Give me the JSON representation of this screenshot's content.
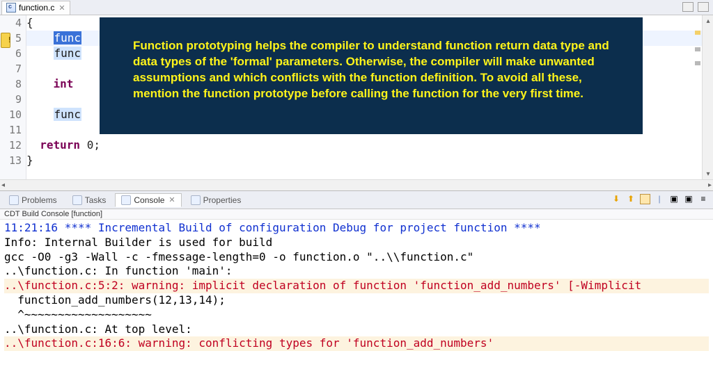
{
  "tab": {
    "filename": "function.c"
  },
  "gutter": [
    "4",
    "5",
    "6",
    "7",
    "8",
    "9",
    "10",
    "11",
    "12",
    "13"
  ],
  "code": {
    "l4": "{",
    "l5a": "    ",
    "l5b": "func",
    "l6a": "    ",
    "l6b": "func",
    "l7": "",
    "l8a": "    ",
    "l8kw": "int",
    "l8b": " ",
    "l9": "",
    "l10a": "    ",
    "l10b": "func",
    "l11": "",
    "l12a": "  ",
    "l12kw": "return",
    "l12b": " 0;",
    "l13": "}"
  },
  "tooltip": "Function prototyping helps the compiler to understand function return data type and data types of the 'formal' parameters. Otherwise, the compiler will make unwanted assumptions and which conflicts with the function definition. To avoid all these, mention the function prototype before calling the function for the very first time.",
  "panel": {
    "tab_problems": "Problems",
    "tab_tasks": "Tasks",
    "tab_console": "Console",
    "tab_properties": "Properties",
    "console_title": "CDT Build Console [function]"
  },
  "console": {
    "l1": "11:21:16 **** Incremental Build of configuration Debug for project function ****",
    "l2": "Info: Internal Builder is used for build",
    "l3": "gcc -O0 -g3 -Wall -c -fmessage-length=0 -o function.o \"..\\\\function.c\"",
    "l4": "..\\function.c: In function 'main':",
    "l5": "..\\function.c:5:2: warning: implicit declaration of function 'function_add_numbers' [-Wimplicit",
    "l6": "  function_add_numbers(12,13,14);",
    "l7": "  ^~~~~~~~~~~~~~~~~~~~",
    "l8": "..\\function.c: At top level:",
    "l9": "..\\function.c:16:6: warning: conflicting types for 'function_add_numbers'"
  }
}
